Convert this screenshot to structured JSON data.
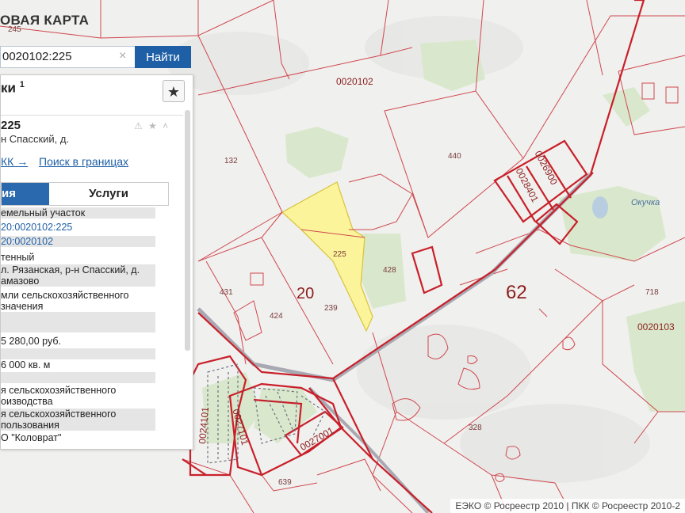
{
  "app": {
    "title": "ОВАЯ КАРТА"
  },
  "search": {
    "value": "0020102:225",
    "clear_icon": "close-icon",
    "button_label": "Найти"
  },
  "panel": {
    "title": "ки",
    "title_sup": "1",
    "star_label": "★",
    "card": {
      "number": "225",
      "icons": "⚠ ★ ˄",
      "address_short": "н Спасский, д.",
      "link_pkk": "КК →",
      "link_bounds": "Поиск в границах",
      "tab_info": "ия",
      "tab_services": "Услуги",
      "rows": [
        "емельный участок",
        "20:0020102:225",
        "20:0020102",
        "тенный",
        "л. Рязанская, р-н Спасский, д.",
        "амазово",
        "мли сельскохозяйственного",
        "значения",
        "",
        "5 280,00 руб.",
        "",
        "6 000 кв. м",
        "",
        "я сельскохозяйственного",
        "оизводства",
        "я сельскохозяйственного",
        "пользования",
        "О \"Коловрат\""
      ]
    }
  },
  "map": {
    "labels": {
      "q102": "0020102",
      "n245": "245",
      "n132": "132",
      "n440": "440",
      "q10069": "0026900",
      "q28401": "0028401",
      "n225": "225",
      "n428": "428",
      "n20": "20",
      "n431": "431",
      "n424": "424",
      "n239": "239",
      "n62": "62",
      "n718": "718",
      "q103": "0020103",
      "n328": "328",
      "n639": "639",
      "q24101": "0024101",
      "q27101": "0027101",
      "q27001": "0027001",
      "village": "Окучка"
    },
    "colors": {
      "boundary": "#c8202a",
      "thin": "#d0484f",
      "parcel_fill": "#fcf49a",
      "forest": "#d9e8cc",
      "ground": "#f0f0ee"
    }
  },
  "attribution": "ЕЭКО © Росреестр 2010 | ПКК © Росреестр 2010-2"
}
